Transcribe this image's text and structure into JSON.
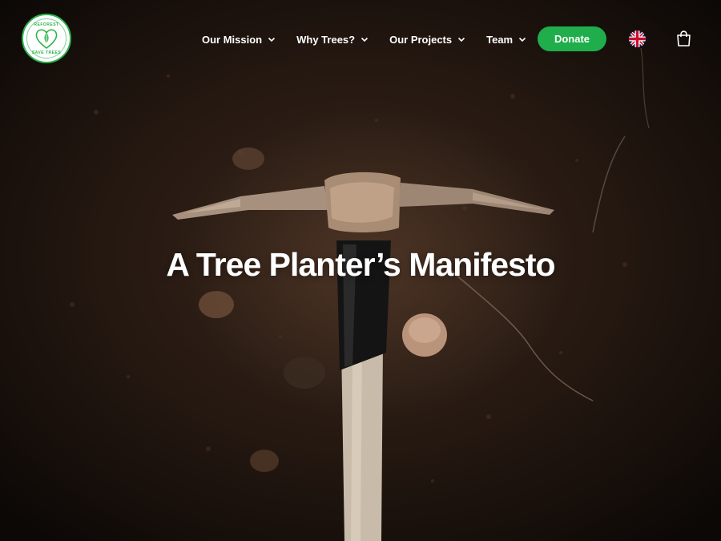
{
  "brand": {
    "logo_text_top": "REFOREST",
    "logo_text_bottom": "SAVE TREES"
  },
  "nav": {
    "items": [
      {
        "label": "Our Mission"
      },
      {
        "label": "Why Trees?"
      },
      {
        "label": "Our Projects"
      },
      {
        "label": "Team"
      }
    ],
    "donate_label": "Donate",
    "language_icon": "uk-flag-icon",
    "cart_icon": "shopping-bag-icon"
  },
  "hero": {
    "title": "A Tree Planter’s Manifesto"
  },
  "colors": {
    "accent": "#1fae4b",
    "text": "#ffffff",
    "soil": "#2a1b13"
  }
}
